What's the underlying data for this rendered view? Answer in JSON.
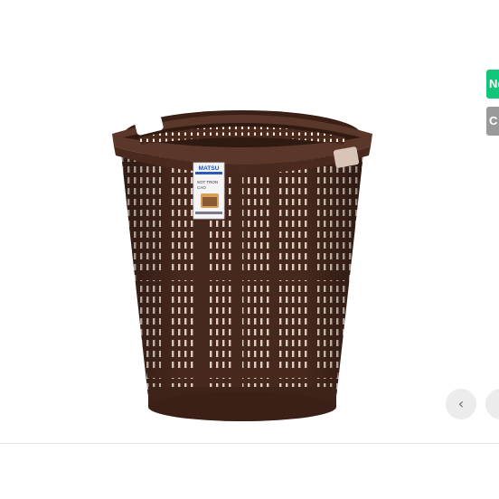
{
  "gallery": {
    "product_image_alt": "Brown round plastic laundry basket",
    "label_tag": {
      "brand": "MATSU",
      "line1": "SOT TRON",
      "line2": "CAO"
    },
    "badges": [
      {
        "label": "New",
        "color": "#12c679"
      },
      {
        "label": "C",
        "color": "#9a9a9a"
      }
    ],
    "prev_icon": "chevron-left-icon",
    "next_icon": "chevron-right-icon",
    "prev_glyph": "‹",
    "next_glyph": "›"
  },
  "colors": {
    "basket": "#4a2a1f",
    "basket_dark": "#3a2016",
    "basket_light": "#5b372a"
  }
}
